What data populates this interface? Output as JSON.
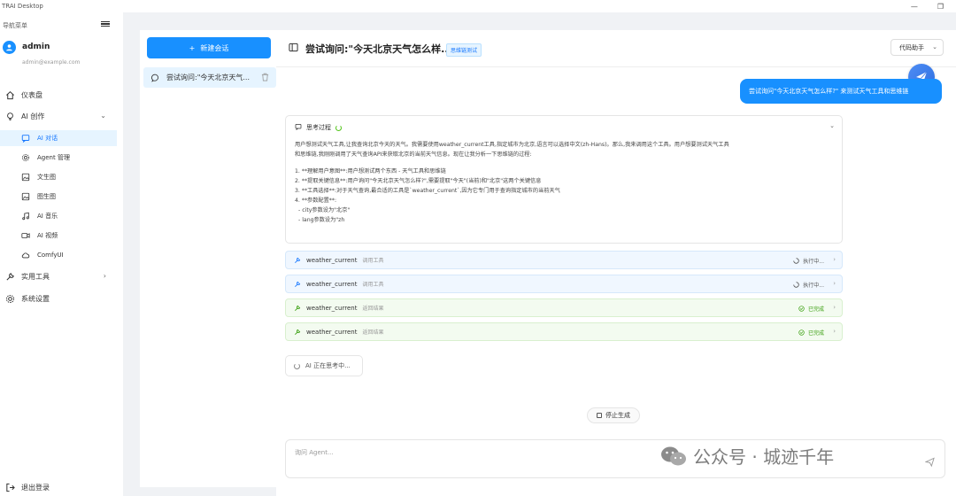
{
  "window": {
    "title": "TRAI Desktop"
  },
  "sidebar": {
    "header": "导航菜单",
    "user": {
      "name": "admin",
      "email": "admin@example.com"
    },
    "items": [
      {
        "label": "仪表盘"
      },
      {
        "label": "AI 创作"
      },
      {
        "label": "AI 对话"
      },
      {
        "label": "Agent 管理"
      },
      {
        "label": "文生图"
      },
      {
        "label": "图生图"
      },
      {
        "label": "AI 音乐"
      },
      {
        "label": "AI 视频"
      },
      {
        "label": "ComfyUI"
      },
      {
        "label": "实用工具"
      },
      {
        "label": "系统设置"
      }
    ],
    "logout": "退出登录"
  },
  "conversations": {
    "new_label": "新建会话",
    "items": [
      {
        "title": "尝试询问:\"今天北京天气..."
      }
    ]
  },
  "chat": {
    "title": "尝试询问:\"今天北京天气怎么样...",
    "mode_tag": "思维链测试",
    "agent": "代码助手",
    "user_message": "尝试询问\"今天北京天气怎么样?\" 来测试天气工具和思维链",
    "thinking": {
      "label": "思考过程",
      "p1": "用户想测试天气工具,让我查询北京今天的天气。我需要使用weather_current工具,指定城市为北京,语言可以选择中文(zh-Hans)。那么,我来调用这个工具。用户想要测试天气工具",
      "p2": "和思维链,我刚刚调用了天气查询API来获取北京的当前天气信息。现在让我分析一下思维链的过程:",
      "s1": "1. **理解用户意图**:用户想测试两个东西 - 天气工具和思维链",
      "s2": "2. **提取关键信息**:用户询问\"今天北京天气怎么样?\",需要提取\"今天\"(当前)和\"北京\"这两个关键信息",
      "s3": "3. **工具选择**:对于天气查询,最合适的工具是`weather_current`,因为它专门用于查询指定城市的当前天气",
      "s4": "4. **参数配置**:",
      "s5": "- city参数设为\"北京\"",
      "s6": "- lang参数设为\"zh"
    },
    "tools": [
      {
        "name": "weather_current",
        "type": "调用工具",
        "status": "执行中..."
      },
      {
        "name": "weather_current",
        "type": "调用工具",
        "status": "执行中..."
      },
      {
        "name": "weather_current",
        "type": "返回结果",
        "status": "已完成"
      },
      {
        "name": "weather_current",
        "type": "返回结果",
        "status": "已完成"
      }
    ],
    "ai_status": "AI 正在思考中...",
    "stop_label": "停止生成",
    "input_placeholder": "询问 Agent..."
  },
  "watermark": {
    "text": "公众号 · 城迹千年"
  },
  "colors": {
    "accent": "#1890ff",
    "done": "#389e0d"
  }
}
